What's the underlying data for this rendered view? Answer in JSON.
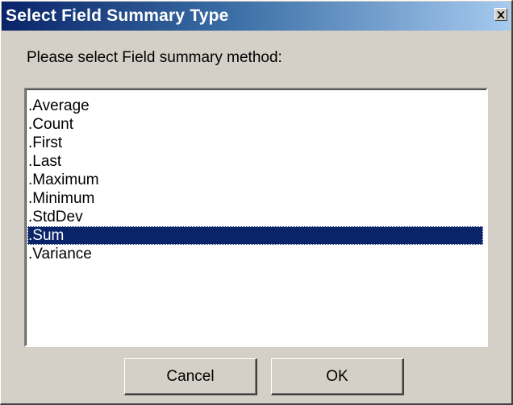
{
  "window": {
    "title": "Select Field Summary Type",
    "close_icon": "close-x-icon"
  },
  "prompt": "Please select Field summary method:",
  "listbox": {
    "items": [
      ".Average",
      ".Count",
      ".First",
      ".Last",
      ".Maximum",
      ".Minimum",
      ".StdDev",
      ".Sum",
      ".Variance"
    ],
    "selected": ".Sum"
  },
  "buttons": {
    "cancel": "Cancel",
    "ok": "OK"
  },
  "colors": {
    "dialog_face": "#d4d0c8",
    "titlebar_start": "#0a246a",
    "titlebar_end": "#a6caf0",
    "selection": "#0a246a"
  }
}
